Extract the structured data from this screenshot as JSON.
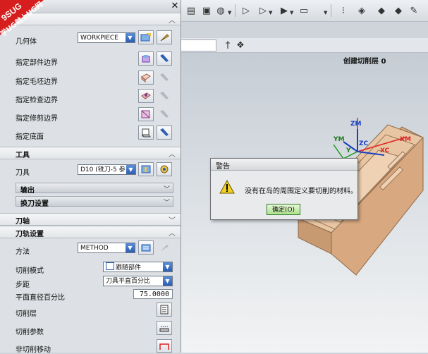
{
  "watermark": {
    "line1": "9SUG",
    "line2": "学UG就上UG网"
  },
  "graphics": {
    "status_text": "创建切削层 0"
  },
  "dialog": {
    "geometry": {
      "workpiece_label": "几何体",
      "workpiece_value": "WORKPIECE",
      "rows": [
        {
          "label": "指定部件边界"
        },
        {
          "label": "指定毛坯边界"
        },
        {
          "label": "指定检查边界"
        },
        {
          "label": "指定修剪边界"
        },
        {
          "label": "指定底面"
        }
      ]
    },
    "tool": {
      "section_label": "工具",
      "tool_label": "刀具",
      "tool_value": "D10 (铣刀-5 参",
      "output_label": "输出",
      "toolchange_label": "换刀设置"
    },
    "axis": {
      "section_label": "刀轴"
    },
    "path": {
      "section_label": "刀轨设置",
      "method_label": "方法",
      "method_value": "METHOD",
      "cut_pattern_label": "切削模式",
      "cut_pattern_value": "跟随部件",
      "stepover_label": "步距",
      "stepover_value": "刀具平直百分比",
      "flat_pct_label": "平面直径百分比",
      "flat_pct_value": "75.0000",
      "cut_levels_label": "切削层",
      "cut_params_label": "切削参数",
      "noncut_label": "非切削移动"
    }
  },
  "warning": {
    "title": "警告",
    "message": "没有在岛的周围定义要切削的材料。",
    "ok_label": "确定(O)"
  },
  "axes": {
    "zm": "ZM",
    "ym": "YM",
    "zc": "ZC",
    "xc": "XC",
    "xm": "XM",
    "y": "Y"
  },
  "colors": {
    "accent_blue": "#2c5db0",
    "ok_green": "#aee08d",
    "part_fill": "#e6c2a0"
  }
}
